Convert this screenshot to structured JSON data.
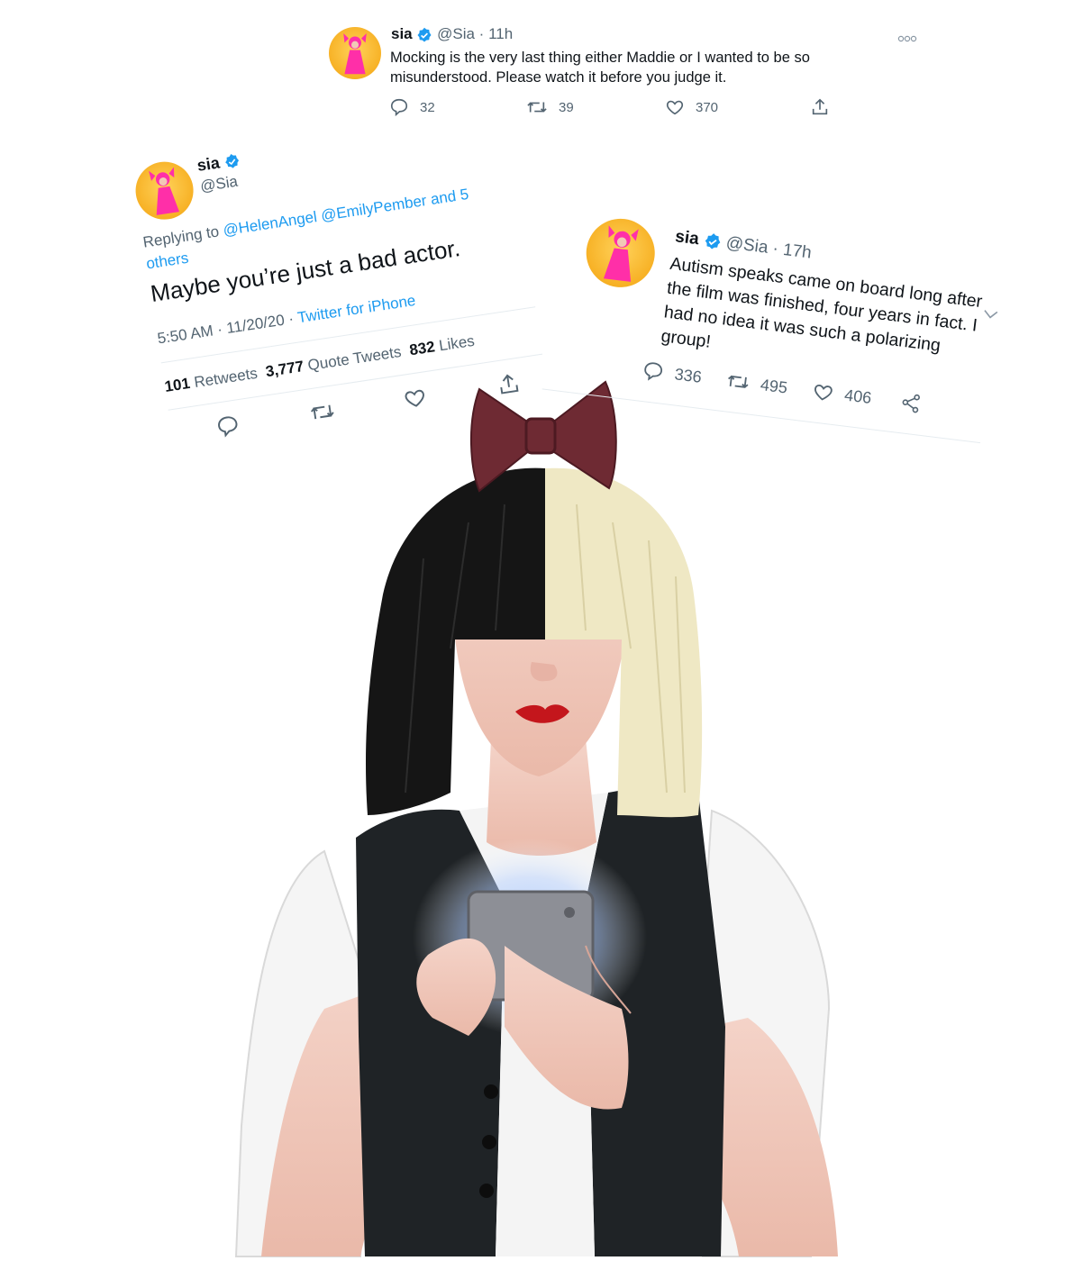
{
  "tweet_top": {
    "name": "sia",
    "handle": "@Sia",
    "time": "11h",
    "text": "Mocking is the very last thing either Maddie or I wanted to be so misunderstood.  Please watch it before you judge it.",
    "replies": "32",
    "retweets": "39",
    "likes": "370"
  },
  "tweet_left": {
    "name": "sia",
    "handle": "@Sia",
    "replying_prefix": "Replying to",
    "replying_to": "@HelenAngel @EmilyPember and 5 others",
    "text": "Maybe you’re just a bad actor.",
    "timestamp": "5:50 AM · 11/20/20 · ",
    "source": "Twitter for iPhone",
    "retweet_count": "101",
    "retweet_label": "Retweets",
    "quote_count": "3,777",
    "quote_label": "Quote Tweets",
    "like_count": "832",
    "like_label": "Likes"
  },
  "tweet_right": {
    "name": "sia",
    "handle": "@Sia",
    "time": "17h",
    "text": "Autism speaks came on  board long after the film was finished, four years in fact. I had no idea it was such a polarizing group!",
    "replies": "336",
    "retweets": "495",
    "likes": "406"
  },
  "colors": {
    "accent": "#1d9bf0",
    "muted": "#536471",
    "avatar_bg": "#f7b125",
    "dress_pink": "#ff2fa8",
    "bow": "#6e2a33",
    "hair_black": "#151515",
    "hair_blonde": "#efe8c4",
    "vest": "#1f2326",
    "skin": "#f2cfc3",
    "lips": "#c4161c",
    "phone": "#8d8f96"
  },
  "icons": [
    "verified-badge-icon",
    "reply-icon",
    "retweet-icon",
    "like-icon",
    "share-icon",
    "more-icon",
    "chevron-down-icon"
  ]
}
